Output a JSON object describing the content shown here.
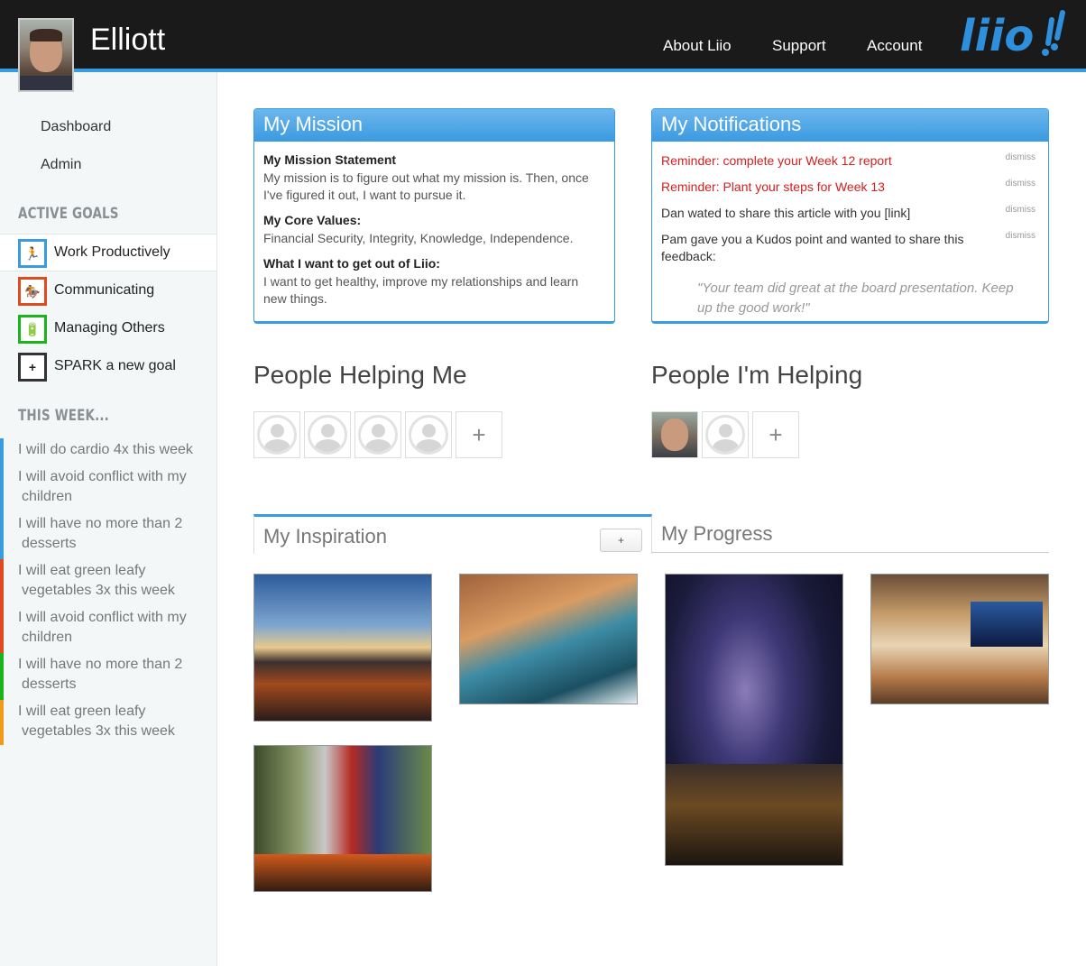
{
  "header": {
    "username": "Elliott",
    "nav": [
      "About Liio",
      "Support",
      "Account"
    ],
    "logo_text": "liio"
  },
  "sidebar": {
    "links": [
      "Dashboard",
      "Admin"
    ],
    "active_goals_heading": "ACTIVE GOALS",
    "goals": [
      {
        "label": "Work Productively",
        "color": "#3a9ce0",
        "icon": "runner-icon",
        "glyph": "🏃"
      },
      {
        "label": "Communicating",
        "color": "#e04a1f",
        "icon": "rider-icon",
        "glyph": "🏇"
      },
      {
        "label": "Managing Others",
        "color": "#19b51a",
        "icon": "bottle-icon",
        "glyph": "🔋"
      },
      {
        "label": "SPARK a new goal",
        "color": "#333333",
        "icon": "plus-icon",
        "glyph": "+"
      }
    ],
    "this_week_heading": "THIS WEEK...",
    "week_items": [
      {
        "text": "I will do cardio 4x this week",
        "color": "#3a9ce0"
      },
      {
        "text": "I will avoid conflict with my children",
        "color": "#3a9ce0"
      },
      {
        "text": "I will have no more than 2 desserts",
        "color": "#3a9ce0"
      },
      {
        "text": "I will eat green leafy vegetables 3x this week",
        "color": "#e04a1f"
      },
      {
        "text": "I will avoid conflict with my children",
        "color": "#e04a1f"
      },
      {
        "text": "I will have no more than 2 desserts",
        "color": "#19b51a"
      },
      {
        "text": "I will eat green leafy vegetables 3x this week",
        "color": "#f09a1a"
      }
    ]
  },
  "mission": {
    "title": "My Mission",
    "statement_label": "My Mission Statement",
    "statement": "My mission is to figure out what my mission is. Then, once I've figured it out, I want to pursue it.",
    "values_label": "My Core Values:",
    "values": "Financial Security, Integrity, Knowledge, Independence.",
    "want_label": "What I want to get out of Liio:",
    "want": "I want to get healthy, improve my relationships and learn new things."
  },
  "notifications": {
    "title": "My Notifications",
    "dismiss_label": "dismiss",
    "items": [
      {
        "text": "Reminder: complete your Week 12 report",
        "alert": true
      },
      {
        "text": "Reminder: Plant your steps for Week 13",
        "alert": true
      },
      {
        "text": "Dan wated to share this article with you [link]",
        "alert": false
      },
      {
        "text": "Pam gave you a Kudos point and wanted to share this feedback:",
        "alert": false
      }
    ],
    "quote": "\"Your team did great at the board presentation. Keep up the good work!\""
  },
  "people": {
    "helping_me_title": "People Helping Me",
    "im_helping_title": "People I'm Helping",
    "add_glyph": "+"
  },
  "tabs": {
    "inspiration": "My Inspiration",
    "progress": "My Progress",
    "add_label": "+"
  },
  "colors": {
    "accent": "#3a9ce0",
    "alert": "#d51e1e"
  }
}
